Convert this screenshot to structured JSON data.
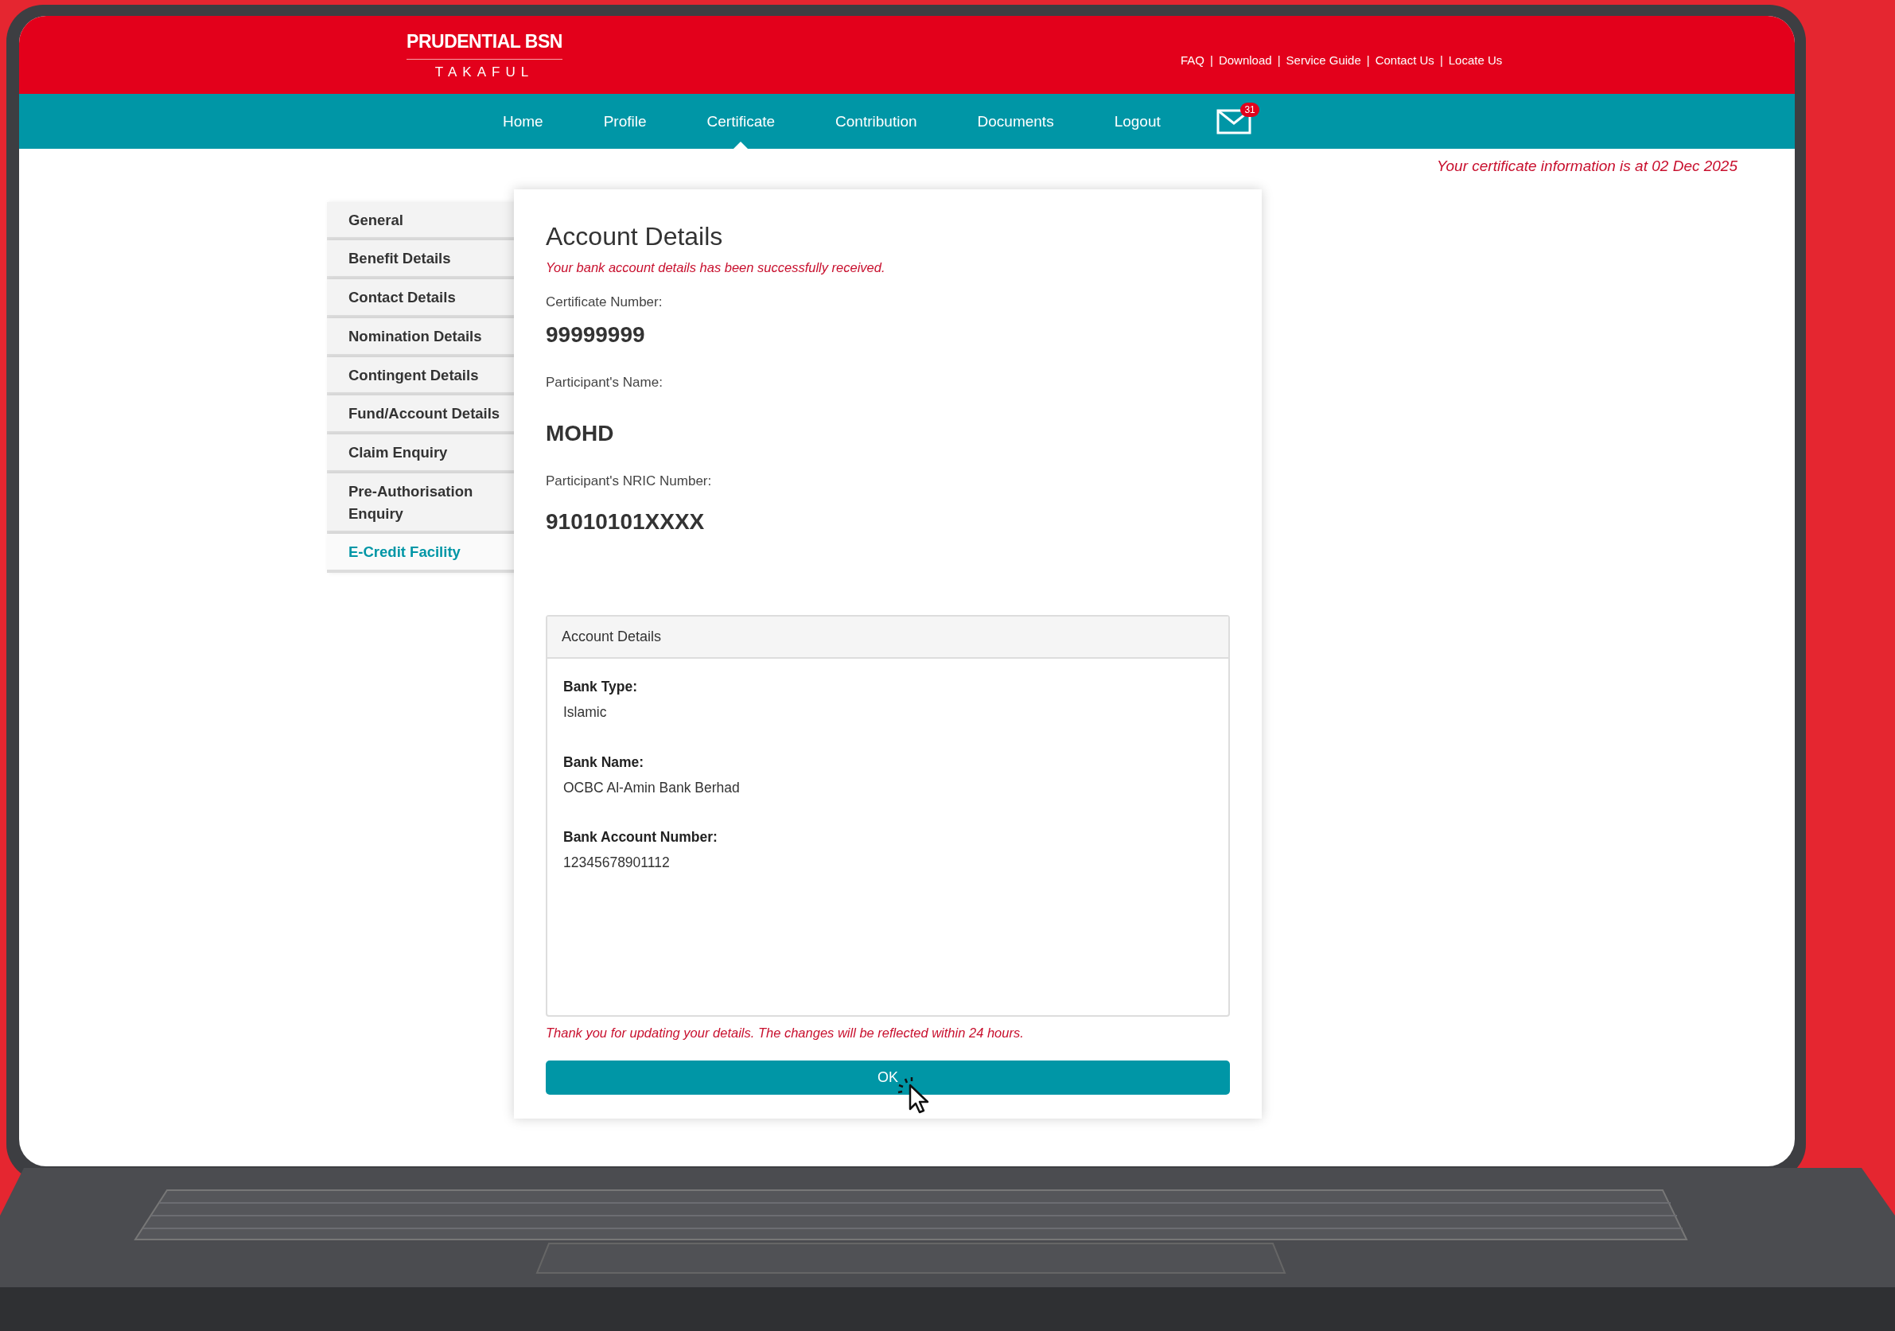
{
  "header": {
    "logo_line1": "PRUDENTIAL BSN",
    "logo_line2": "TAKAFUL",
    "link_separator": "|",
    "top_links": [
      "FAQ",
      "Download",
      "Service Guide",
      "Contact Us",
      "Locate Us"
    ]
  },
  "nav": [
    {
      "label": "Home",
      "selected": false
    },
    {
      "label": "Profile",
      "selected": false
    },
    {
      "label": "Certificate",
      "selected": true
    },
    {
      "label": "Contribution",
      "selected": false
    },
    {
      "label": "Documents",
      "selected": false
    },
    {
      "label": "Logout",
      "selected": false
    }
  ],
  "mail_badge": "31",
  "info_notice": "Your certificate information is at 02 Dec 2025",
  "sidebar": [
    {
      "label": "General",
      "selected": false
    },
    {
      "label": "Benefit Details",
      "selected": false
    },
    {
      "label": "Contact Details",
      "selected": false
    },
    {
      "label": "Nomination Details",
      "selected": false
    },
    {
      "label": "Contingent Details",
      "selected": false
    },
    {
      "label": "Fund/Account Details",
      "selected": false
    },
    {
      "label": "Claim Enquiry",
      "selected": false
    },
    {
      "label": "Pre-Authorisation Enquiry",
      "selected": false
    },
    {
      "label": "E-Credit Facility",
      "selected": true
    }
  ],
  "card": {
    "title": "Account Details",
    "success": "Your bank account details has been successfully received.",
    "fields": [
      {
        "label": "Certificate Number:",
        "value": "99999999"
      },
      {
        "label": "Participant's Name:",
        "value": "MOHD"
      },
      {
        "label": "Participant's NRIC Number:",
        "value": "91010101XXXX"
      }
    ],
    "panel": {
      "title": "Account Details",
      "items": [
        {
          "label": "Bank Type:",
          "value": "Islamic"
        },
        {
          "label": "Bank Name:",
          "value": "OCBC Al-Amin Bank Berhad"
        },
        {
          "label": "Bank Account Number:",
          "value": "12345678901112"
        }
      ]
    },
    "footer_note": "Thank you for updating your details. The changes will be reflected within 24 hours.",
    "button": "OK"
  }
}
